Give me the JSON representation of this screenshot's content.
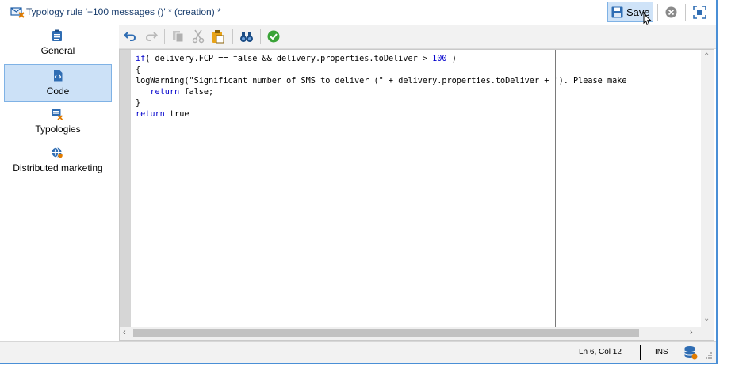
{
  "window": {
    "title": "Typology rule '+100 messages ()' * (creation) *",
    "save_label": "Save",
    "colors": {
      "accent": "#4a8fd6",
      "active_bg": "#cce1f7",
      "keyword": "#0000cc"
    }
  },
  "sidebar": {
    "items": [
      {
        "label": "General",
        "icon": "clipboard-icon",
        "active": false
      },
      {
        "label": "Code",
        "icon": "code-file-icon",
        "active": true
      },
      {
        "label": "Typologies",
        "icon": "typologies-icon",
        "active": false
      },
      {
        "label": "Distributed marketing",
        "icon": "distributed-marketing-icon",
        "active": false
      }
    ]
  },
  "toolbar": {
    "buttons": [
      "undo-icon",
      "redo-icon",
      "copy-icon",
      "cut-icon",
      "paste-icon",
      "find-icon",
      "check-syntax-icon"
    ]
  },
  "editor": {
    "lines": [
      [
        {
          "t": "if",
          "c": "kw"
        },
        {
          "t": "( delivery.FCP == false && delivery.properties.toDeliver > ",
          "c": ""
        },
        {
          "t": "100",
          "c": "num"
        },
        {
          "t": " )",
          "c": ""
        }
      ],
      [
        {
          "t": "{",
          "c": ""
        }
      ],
      [
        {
          "t": "logWarning(\"Significant number of SMS to deliver (\" + delivery.properties.toDeliver + \"). Please make",
          "c": ""
        }
      ],
      [
        {
          "t": "   ",
          "c": ""
        },
        {
          "t": "return",
          "c": "kw"
        },
        {
          "t": " false;",
          "c": ""
        }
      ],
      [
        {
          "t": "}",
          "c": ""
        }
      ],
      [
        {
          "t": "return",
          "c": "kw"
        },
        {
          "t": " true",
          "c": ""
        }
      ]
    ]
  },
  "status": {
    "position": "Ln 6, Col 12",
    "mode": "INS"
  }
}
